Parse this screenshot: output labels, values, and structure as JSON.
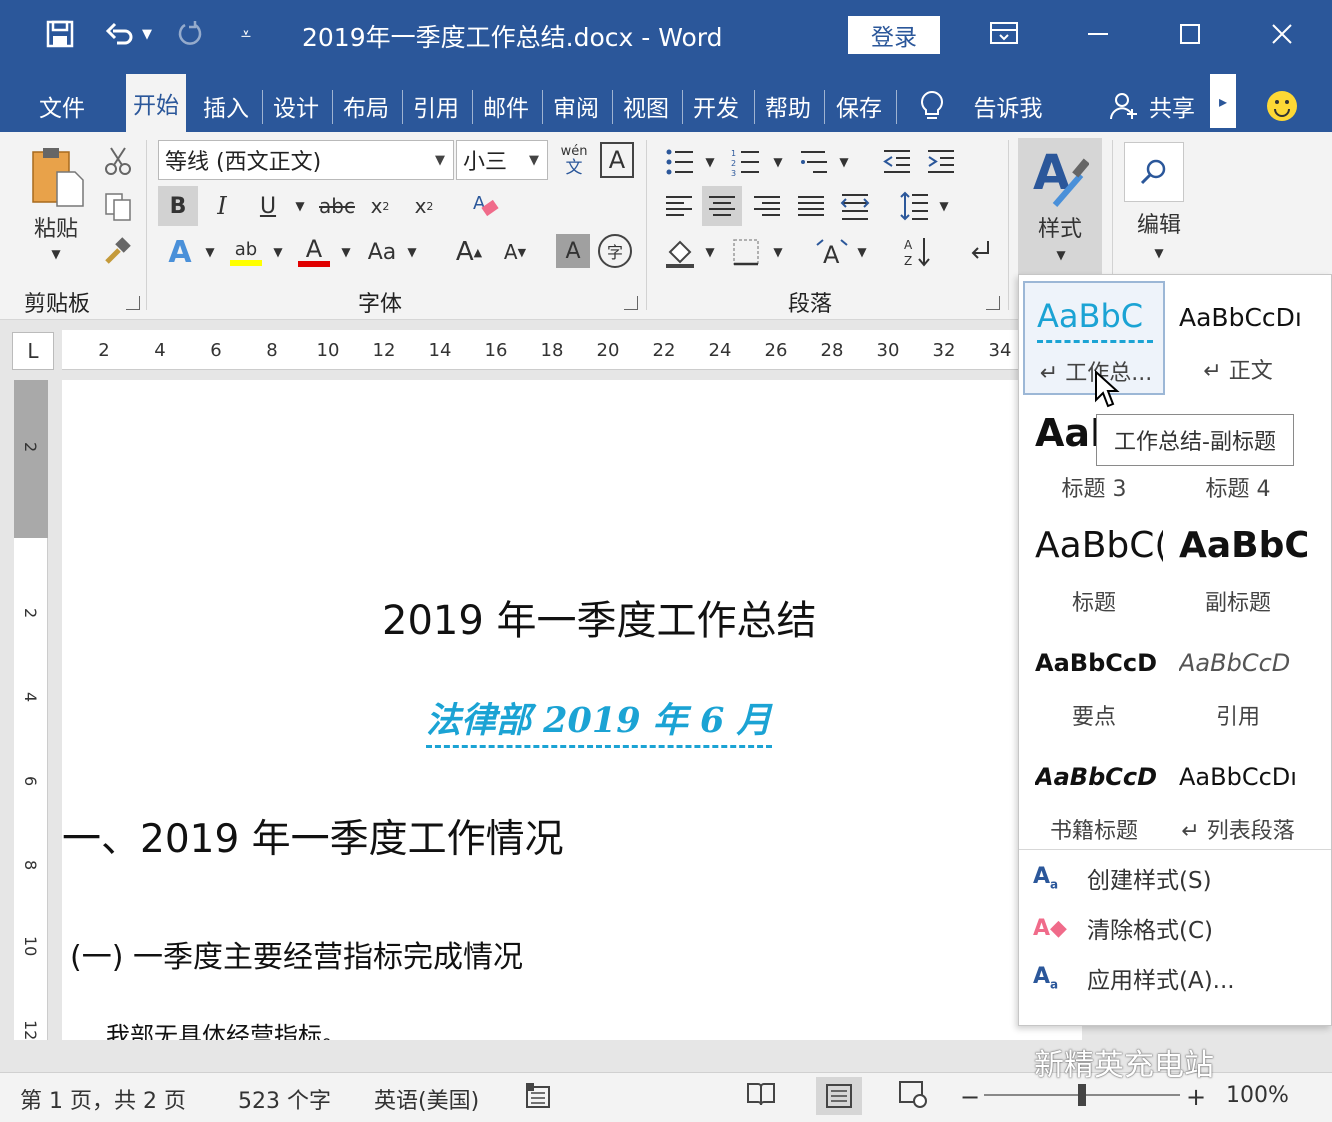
{
  "titlebar": {
    "doc_title": "2019年一季度工作总结.docx  -  Word",
    "login": "登录",
    "icons": [
      "save-icon",
      "undo-icon",
      "redo-icon",
      "customize-qat-icon",
      "ribbon-display-icon",
      "minimize-icon",
      "maximize-icon",
      "close-icon"
    ]
  },
  "tabs": {
    "file": "文件",
    "home": "开始",
    "insert": "插入",
    "design": "设计",
    "layout": "布局",
    "references": "引用",
    "mailings": "邮件",
    "review": "审阅",
    "view": "视图",
    "developer": "开发",
    "help": "帮助",
    "save": "保存",
    "tellme": "告诉我",
    "share": "共享"
  },
  "ribbon": {
    "clipboard": {
      "paste": "粘贴",
      "label": "剪贴板"
    },
    "font": {
      "name": "等线 (西文正文)",
      "size": "小三",
      "label": "字体",
      "phonetic": "wén",
      "aa": "Aa"
    },
    "paragraph": {
      "label": "段落"
    },
    "styles": {
      "label": "样式"
    },
    "editing": {
      "label": "编辑"
    }
  },
  "ruler": {
    "corner": "L",
    "ticks": [
      "2",
      "4",
      "6",
      "8",
      "10",
      "12",
      "14",
      "16",
      "18",
      "20",
      "22",
      "24",
      "26",
      "28",
      "30",
      "32",
      "34"
    ],
    "vticks": [
      "2",
      "2",
      "4",
      "6",
      "8",
      "10",
      "12"
    ]
  },
  "document": {
    "title": "2019 年一季度工作总结",
    "subtitle": "法律部 2019 年 6 月",
    "heading1": "一、2019 年一季度工作情况",
    "heading2": "(一) 一季度主要经营指标完成情况",
    "paragraph": "我部无具体经营指标。"
  },
  "styles_gallery": {
    "items": [
      {
        "preview": "AaBbC",
        "name": "↵ 工作总..."
      },
      {
        "preview": "AaBbCcDı",
        "name": "↵ 正文"
      },
      {
        "preview": "AaE",
        "name": "标题 3"
      },
      {
        "preview": "",
        "name": "标题 4"
      },
      {
        "preview": "AaBbC(",
        "name": "标题"
      },
      {
        "preview": "AaBbC(",
        "name": "副标题"
      },
      {
        "preview": "AaBbCcD",
        "name": "要点"
      },
      {
        "preview": "AaBbCcD",
        "name": "引用"
      },
      {
        "preview": "AaBbCcD",
        "name": "书籍标题"
      },
      {
        "preview": "AaBbCcDı",
        "name": "↵ 列表段落"
      }
    ],
    "tooltip": "工作总结-副标题",
    "menu": {
      "create": "创建样式(S)",
      "clear": "清除格式(C)",
      "apply": "应用样式(A)..."
    }
  },
  "statusbar": {
    "page": "第 1 页，共 2 页",
    "words": "523 个字",
    "language": "英语(美国)",
    "zoom_minus": "−",
    "zoom_plus": "+",
    "zoom": "100%",
    "zoom_level": 0.5
  },
  "watermark": "新精英充电站",
  "colors": {
    "word_blue": "#2b579a",
    "subtitle": "#1ba3d4",
    "font_red": "#e00000",
    "highlight": "#ffff00"
  }
}
